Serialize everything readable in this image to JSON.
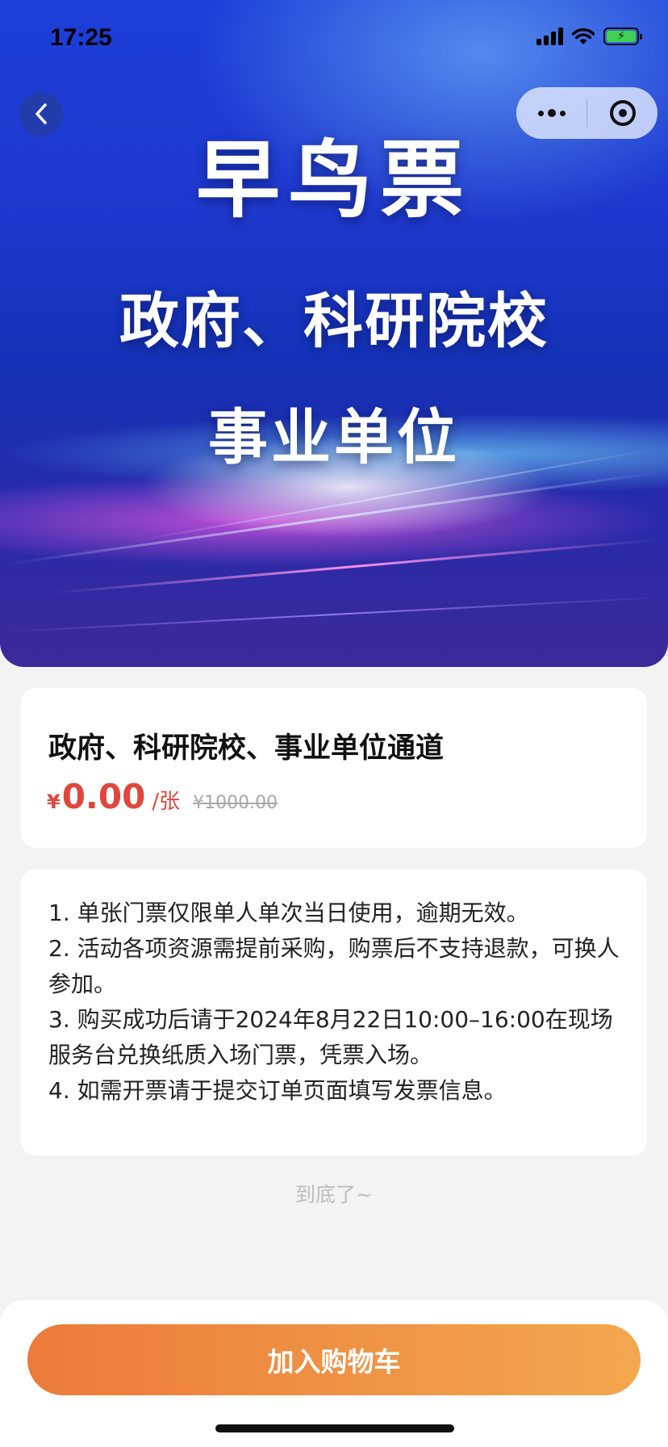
{
  "status_bar": {
    "time": "17:25",
    "icons": [
      "signal-icon",
      "wifi-icon",
      "battery-charging-icon"
    ]
  },
  "banner": {
    "title": "早鸟票",
    "subtitle_line1": "政府、科研院校",
    "subtitle_line2": "事业单位"
  },
  "nav": {
    "back_icon": "chevron-left-icon",
    "more_icon": "more-dots-icon",
    "close_icon": "target-circle-icon"
  },
  "product": {
    "name": "政府、科研院校、事业单位通道",
    "currency_symbol": "¥",
    "price": "0.00",
    "unit": "/张",
    "original_price": "¥1000.00",
    "price_color": "#e0463b"
  },
  "notice": {
    "items": [
      "1. 单张门票仅限单人单次当日使用，逾期无效。",
      "2. 活动各项资源需提前采购，购票后不支持退款，可换人参加。",
      "3. 购买成功后请于2024年8月22日10:00–16:00在现场服务台兑换纸质入场门票，凭票入场。",
      "4. 如需开票请于提交订单页面填写发票信息。"
    ]
  },
  "footer": {
    "end_text": "到底了~",
    "cart_button_label": "加入购物车",
    "button_color": "#ef8f43"
  }
}
